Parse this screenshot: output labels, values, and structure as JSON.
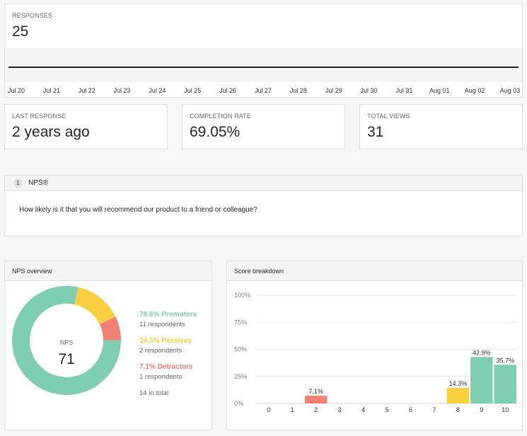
{
  "responses": {
    "label": "RESPONSES",
    "value": "25",
    "dates": [
      "Jul 20",
      "Jul 21",
      "Jul 22",
      "Jul 23",
      "Jul 24",
      "Jul 25",
      "Jul 26",
      "Jul 27",
      "Jul 28",
      "Jul 29",
      "Jul 30",
      "Jul 31",
      "Aug 01",
      "Aug 02",
      "Aug 03"
    ]
  },
  "stats": [
    {
      "label": "LAST RESPONSE",
      "value": "2 years ago"
    },
    {
      "label": "COMPLETION RATE",
      "value": "69.05%"
    },
    {
      "label": "TOTAL VIEWS",
      "value": "31"
    }
  ],
  "question": {
    "number": "1",
    "title": "NPS®",
    "text": "How likely is it that you will recommend our product to a friend or colleague?"
  },
  "overview": {
    "title": "NPS overview",
    "center_label": "NPS",
    "center_value": "71",
    "promoters": {
      "label": "78.6% Promoters",
      "sub": "11 respondents",
      "percent": 78.6,
      "color": "#7ecfb1"
    },
    "passives": {
      "label": "14.3% Passives",
      "sub": "2 respondents",
      "percent": 14.3,
      "color": "#f9d140"
    },
    "detractors": {
      "label": "7.1% Detractors",
      "sub": "1 respondents",
      "percent": 7.1,
      "color": "#f08173"
    },
    "total": "14 in total"
  },
  "chart_data": {
    "type": "bar",
    "title": "Score breakdown",
    "categories": [
      "0",
      "1",
      "2",
      "3",
      "4",
      "5",
      "6",
      "7",
      "8",
      "9",
      "10"
    ],
    "values": [
      0,
      0,
      7.1,
      0,
      0,
      0,
      0,
      0,
      14.3,
      42.9,
      35.7
    ],
    "data_labels": [
      "",
      "",
      "7.1%",
      "",
      "",
      "",
      "",
      "",
      "14.3%",
      "42.9%",
      "35.7%"
    ],
    "colors": [
      "#f08173",
      "#f08173",
      "#f08173",
      "#f08173",
      "#f08173",
      "#f08173",
      "#f08173",
      "#f9d140",
      "#f9d140",
      "#7ecfb1",
      "#7ecfb1"
    ],
    "yticks": [
      "0%",
      "25%",
      "50%",
      "75%",
      "100%"
    ],
    "ylim": [
      0,
      100
    ],
    "grid": true
  }
}
